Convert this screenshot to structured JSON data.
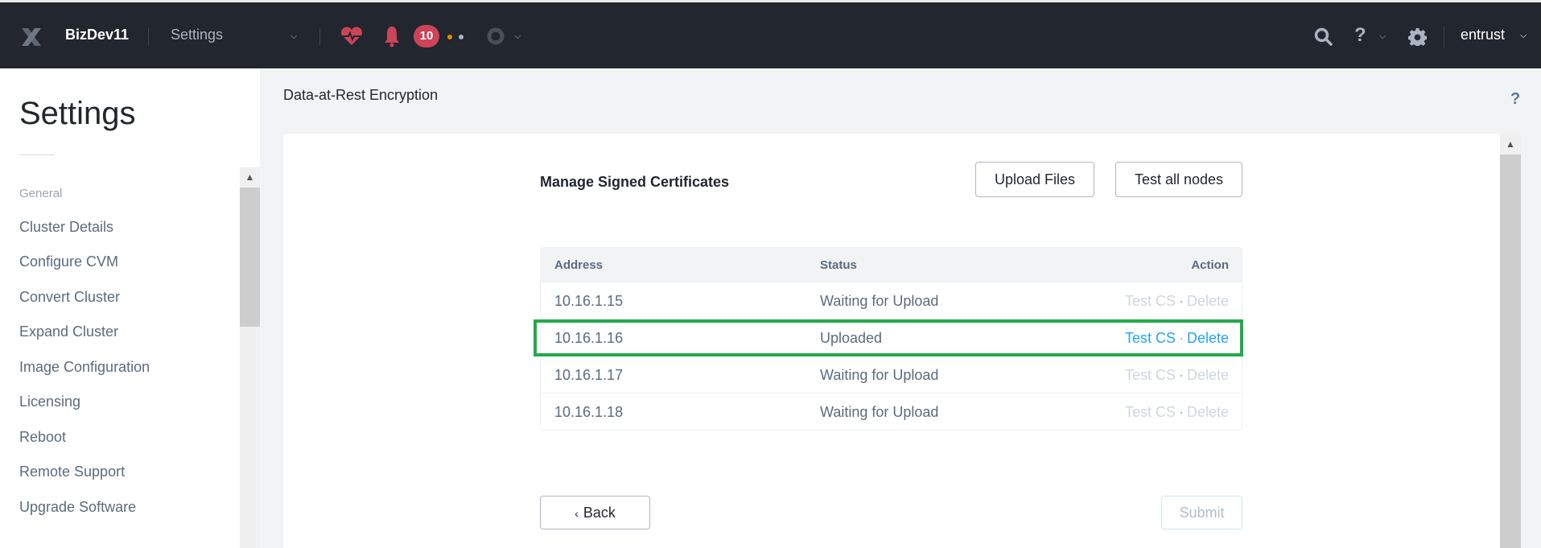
{
  "header": {
    "logo": "nutanix-x-logo",
    "cluster_name": "BizDev11",
    "nav_select": "Settings",
    "alert_count": "10",
    "status_colors": {
      "heart": "#cc4458",
      "bell": "#cc4458",
      "dot_warning": "#e58a00",
      "dot_info": "#a9b3c1"
    },
    "user_name": "entrust",
    "icons": [
      "health-heart-icon",
      "alerts-bell-icon",
      "tasks-circle-icon",
      "search-icon",
      "help-icon",
      "gear-icon"
    ]
  },
  "sidebar": {
    "title": "Settings",
    "group_label": "General",
    "items": [
      {
        "label": "Cluster Details"
      },
      {
        "label": "Configure CVM"
      },
      {
        "label": "Convert Cluster"
      },
      {
        "label": "Expand Cluster"
      },
      {
        "label": "Image Configuration"
      },
      {
        "label": "Licensing"
      },
      {
        "label": "Reboot"
      },
      {
        "label": "Remote Support"
      },
      {
        "label": "Upgrade Software"
      }
    ]
  },
  "main": {
    "page_title": "Data-at-Rest Encryption",
    "help_label": "?",
    "section_title": "Manage Signed Certificates",
    "upload_button": "Upload Files",
    "test_all_button": "Test all nodes",
    "table": {
      "columns": [
        "Address",
        "Status",
        "Action"
      ],
      "rows": [
        {
          "address": "10.16.1.15",
          "status": "Waiting for Upload",
          "test": "Test CS",
          "sep": "·",
          "delete": "Delete",
          "enabled": false
        },
        {
          "address": "10.16.1.16",
          "status": "Uploaded",
          "test": "Test CS",
          "sep": "·",
          "delete": "Delete",
          "enabled": true
        },
        {
          "address": "10.16.1.17",
          "status": "Waiting for Upload",
          "test": "Test CS",
          "sep": "·",
          "delete": "Delete",
          "enabled": false
        },
        {
          "address": "10.16.1.18",
          "status": "Waiting for Upload",
          "test": "Test CS",
          "sep": "·",
          "delete": "Delete",
          "enabled": false
        }
      ]
    },
    "highlight_color": "#22aa4a",
    "link_color": "#22a5f7",
    "back_button": "Back",
    "submit_button": "Submit"
  }
}
